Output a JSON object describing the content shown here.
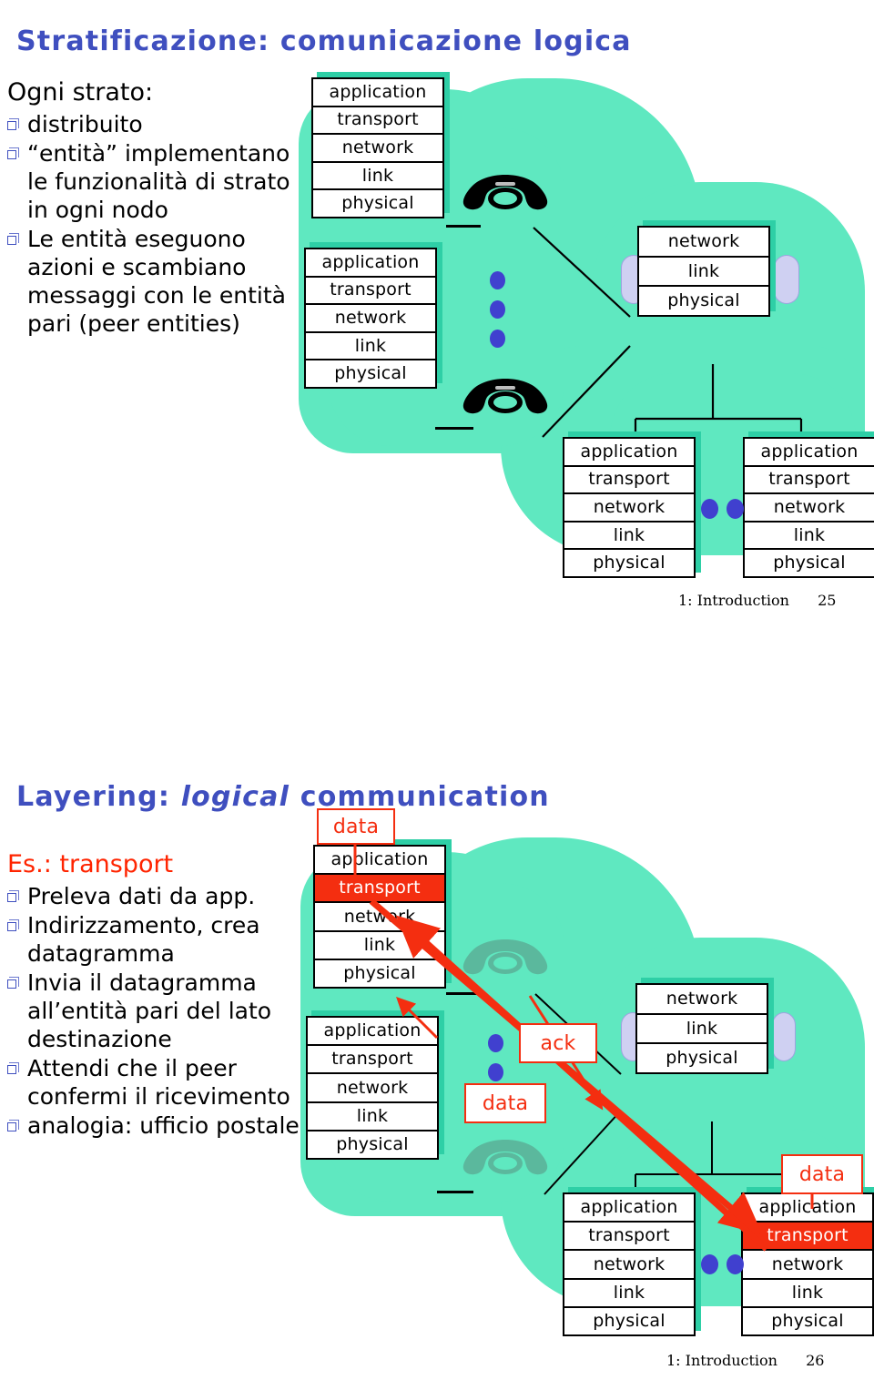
{
  "colors": {
    "title_blue": "#3f4fbf",
    "mint": "#5fe8c0",
    "mint_shadow": "#2ecfa6",
    "accent_red": "#f42e10",
    "dot_blue": "#4040cf",
    "cylinder": "#cfd0f2"
  },
  "layer_names": {
    "application": "application",
    "transport": "transport",
    "network": "network",
    "link": "link",
    "physical": "physical"
  },
  "slide1": {
    "title": "Stratificazione: comunicazione logica",
    "lead": "Ogni strato:",
    "bullets": [
      "distribuito",
      "“entità” implementano le funzionalità di strato in ogni nodo",
      "Le entità eseguono azioni e scambiano messaggi con le entità pari (peer entities)"
    ],
    "diagram": {
      "host_a_layers": [
        "application",
        "transport",
        "network",
        "link",
        "physical"
      ],
      "host_b_layers": [
        "application",
        "transport",
        "network",
        "link",
        "physical"
      ],
      "router_layers": [
        "network",
        "link",
        "physical"
      ],
      "host_c_layers": [
        "application",
        "transport",
        "network",
        "link",
        "physical"
      ],
      "host_d_layers": [
        "application",
        "transport",
        "network",
        "link",
        "physical"
      ],
      "phone_icons": [
        "telephone-icon",
        "telephone-icon"
      ],
      "ellipsis_dots_vertical": 3,
      "ellipsis_dots_horizontal": 2
    },
    "footer": {
      "label": "1: Introduction",
      "page": "25"
    }
  },
  "slide2": {
    "title_prefix": "Layering: ",
    "title_italic": "logical",
    "title_suffix": " communication",
    "lead": "Es.: transport",
    "bullets": [
      "Preleva dati da app.",
      "Indirizzamento, crea datagramma",
      "Invia il datagramma all’entità pari del lato destinazione",
      "Attendi che il peer confermi il ricevimento",
      "analogia: ufficio postale"
    ],
    "diagram": {
      "host_a_layers": [
        "application",
        "transport",
        "network",
        "link",
        "physical"
      ],
      "host_a_highlight": "transport",
      "host_b_layers": [
        "application",
        "transport",
        "network",
        "link",
        "physical"
      ],
      "router_layers": [
        "network",
        "link",
        "physical"
      ],
      "host_c_layers": [
        "application",
        "transport",
        "network",
        "link",
        "physical"
      ],
      "host_d_layers": [
        "application",
        "transport",
        "network",
        "link",
        "physical"
      ],
      "host_d_highlight": "transport",
      "tags": [
        {
          "name": "data-tag-top-left",
          "text": "data"
        },
        {
          "name": "ack-tag",
          "text": "ack"
        },
        {
          "name": "data-tag-middle",
          "text": "data"
        },
        {
          "name": "data-tag-bottom-right",
          "text": "data"
        }
      ],
      "phone_icons": [
        "telephone-icon",
        "telephone-icon"
      ],
      "ellipsis_dots_vertical": 3,
      "ellipsis_dots_horizontal": 2
    },
    "footer": {
      "label": "1: Introduction",
      "page": "26"
    }
  }
}
